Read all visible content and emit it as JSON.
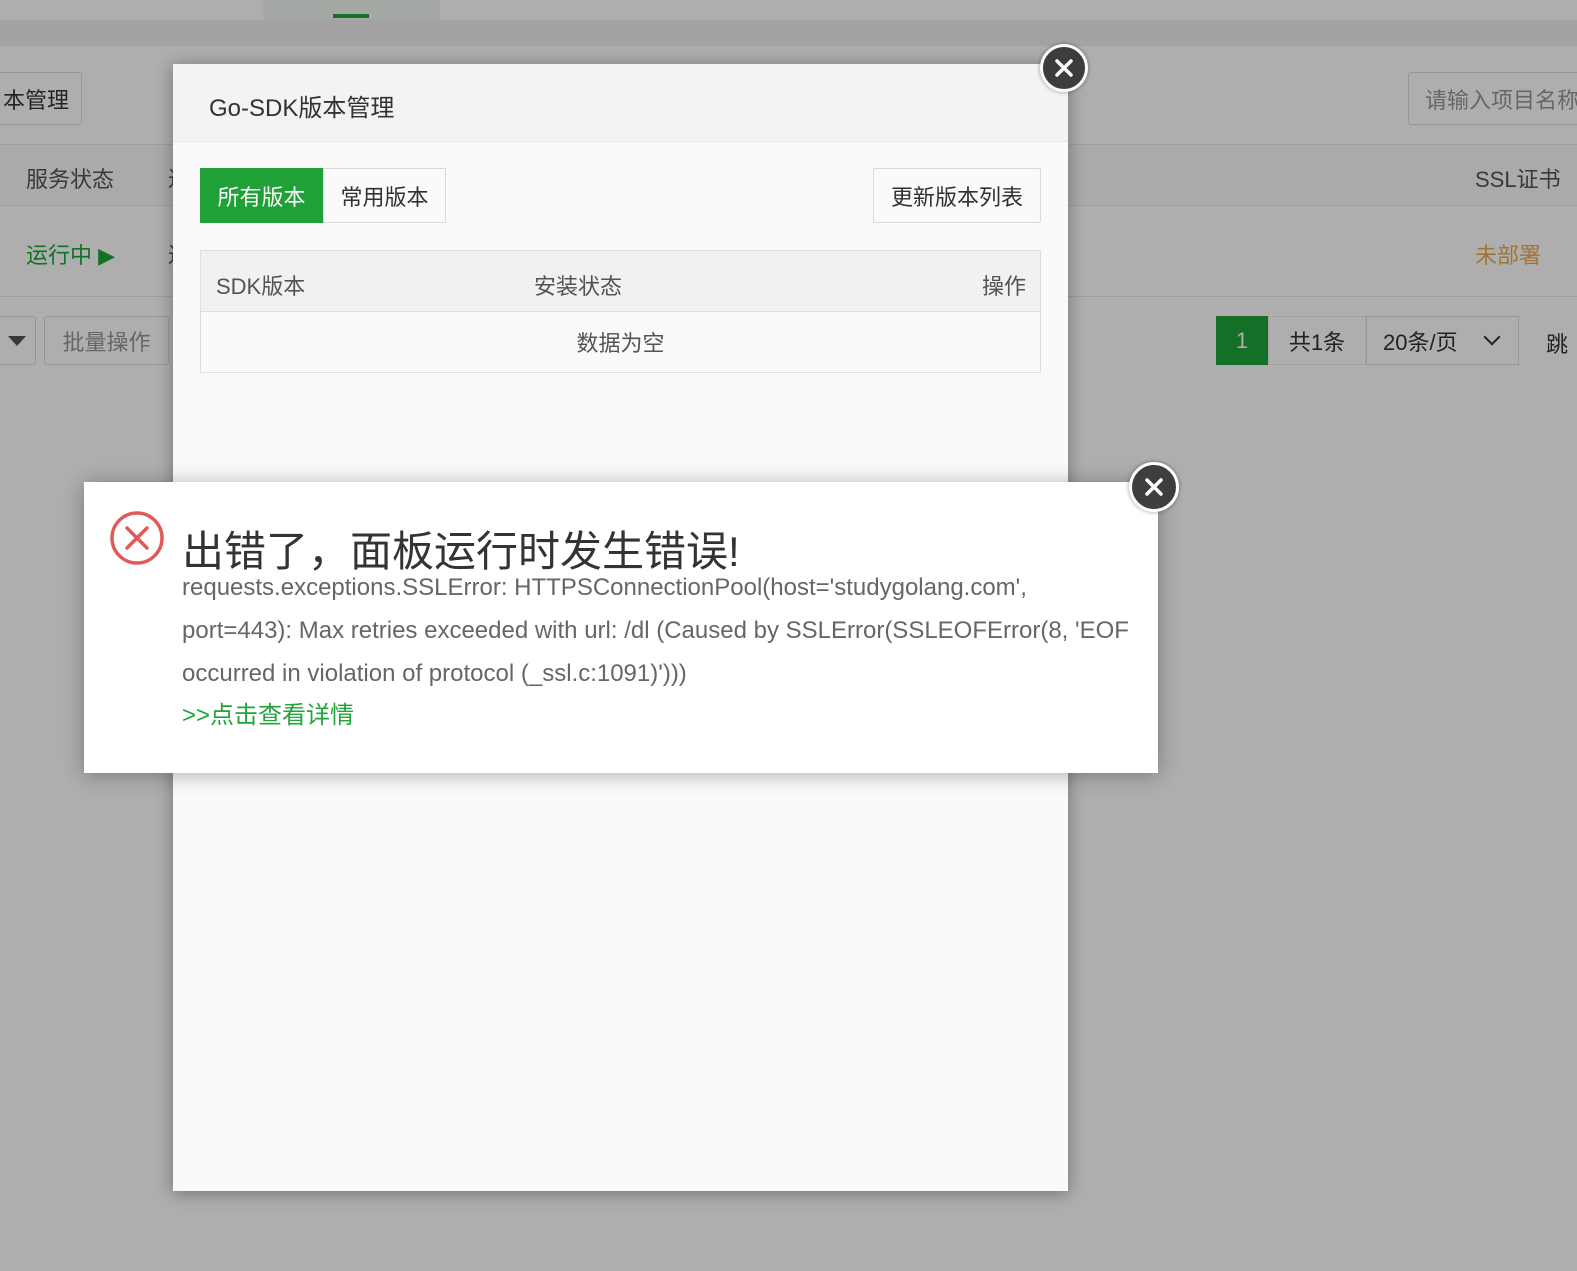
{
  "colors": {
    "brand_green": "#20a53a",
    "warning_orange": "#f0ad4e",
    "error_red": "#e15a5a"
  },
  "background": {
    "toolbar": {
      "manage_button": "本管理",
      "search_placeholder": "请输入项目名称"
    },
    "table": {
      "col_status": "服务状态",
      "col_partial": "过",
      "col_ssl": "SSL证书"
    },
    "row": {
      "status": "运行中 ▶",
      "partial": "过",
      "ssl_status": "未部署"
    },
    "footer": {
      "batch_button": "批量操作",
      "current_page": "1",
      "total": "共1条",
      "page_size": "20条/页",
      "jump_partial": "跳"
    }
  },
  "sdk_dialog": {
    "title": "Go-SDK版本管理",
    "tabs": [
      "所有版本",
      "常用版本"
    ],
    "active_tab": "所有版本",
    "refresh_button": "更新版本列表",
    "table": {
      "headers": [
        "SDK版本",
        "安装状态",
        "操作"
      ],
      "empty_text": "数据为空"
    },
    "close_icon": "close-icon"
  },
  "error_dialog": {
    "title": "出错了，面板运行时发生错误!",
    "message": "requests.exceptions.SSLError: HTTPSConnectionPool(host='studygolang.com', port=443): Max retries exceeded with url: /dl (Caused by SSLError(SSLEOFError(8, 'EOF occurred in violation of protocol (_ssl.c:1091)')))",
    "details_link": ">>点击查看详情",
    "icon": "error-circle-x-icon",
    "close_icon": "close-icon"
  }
}
